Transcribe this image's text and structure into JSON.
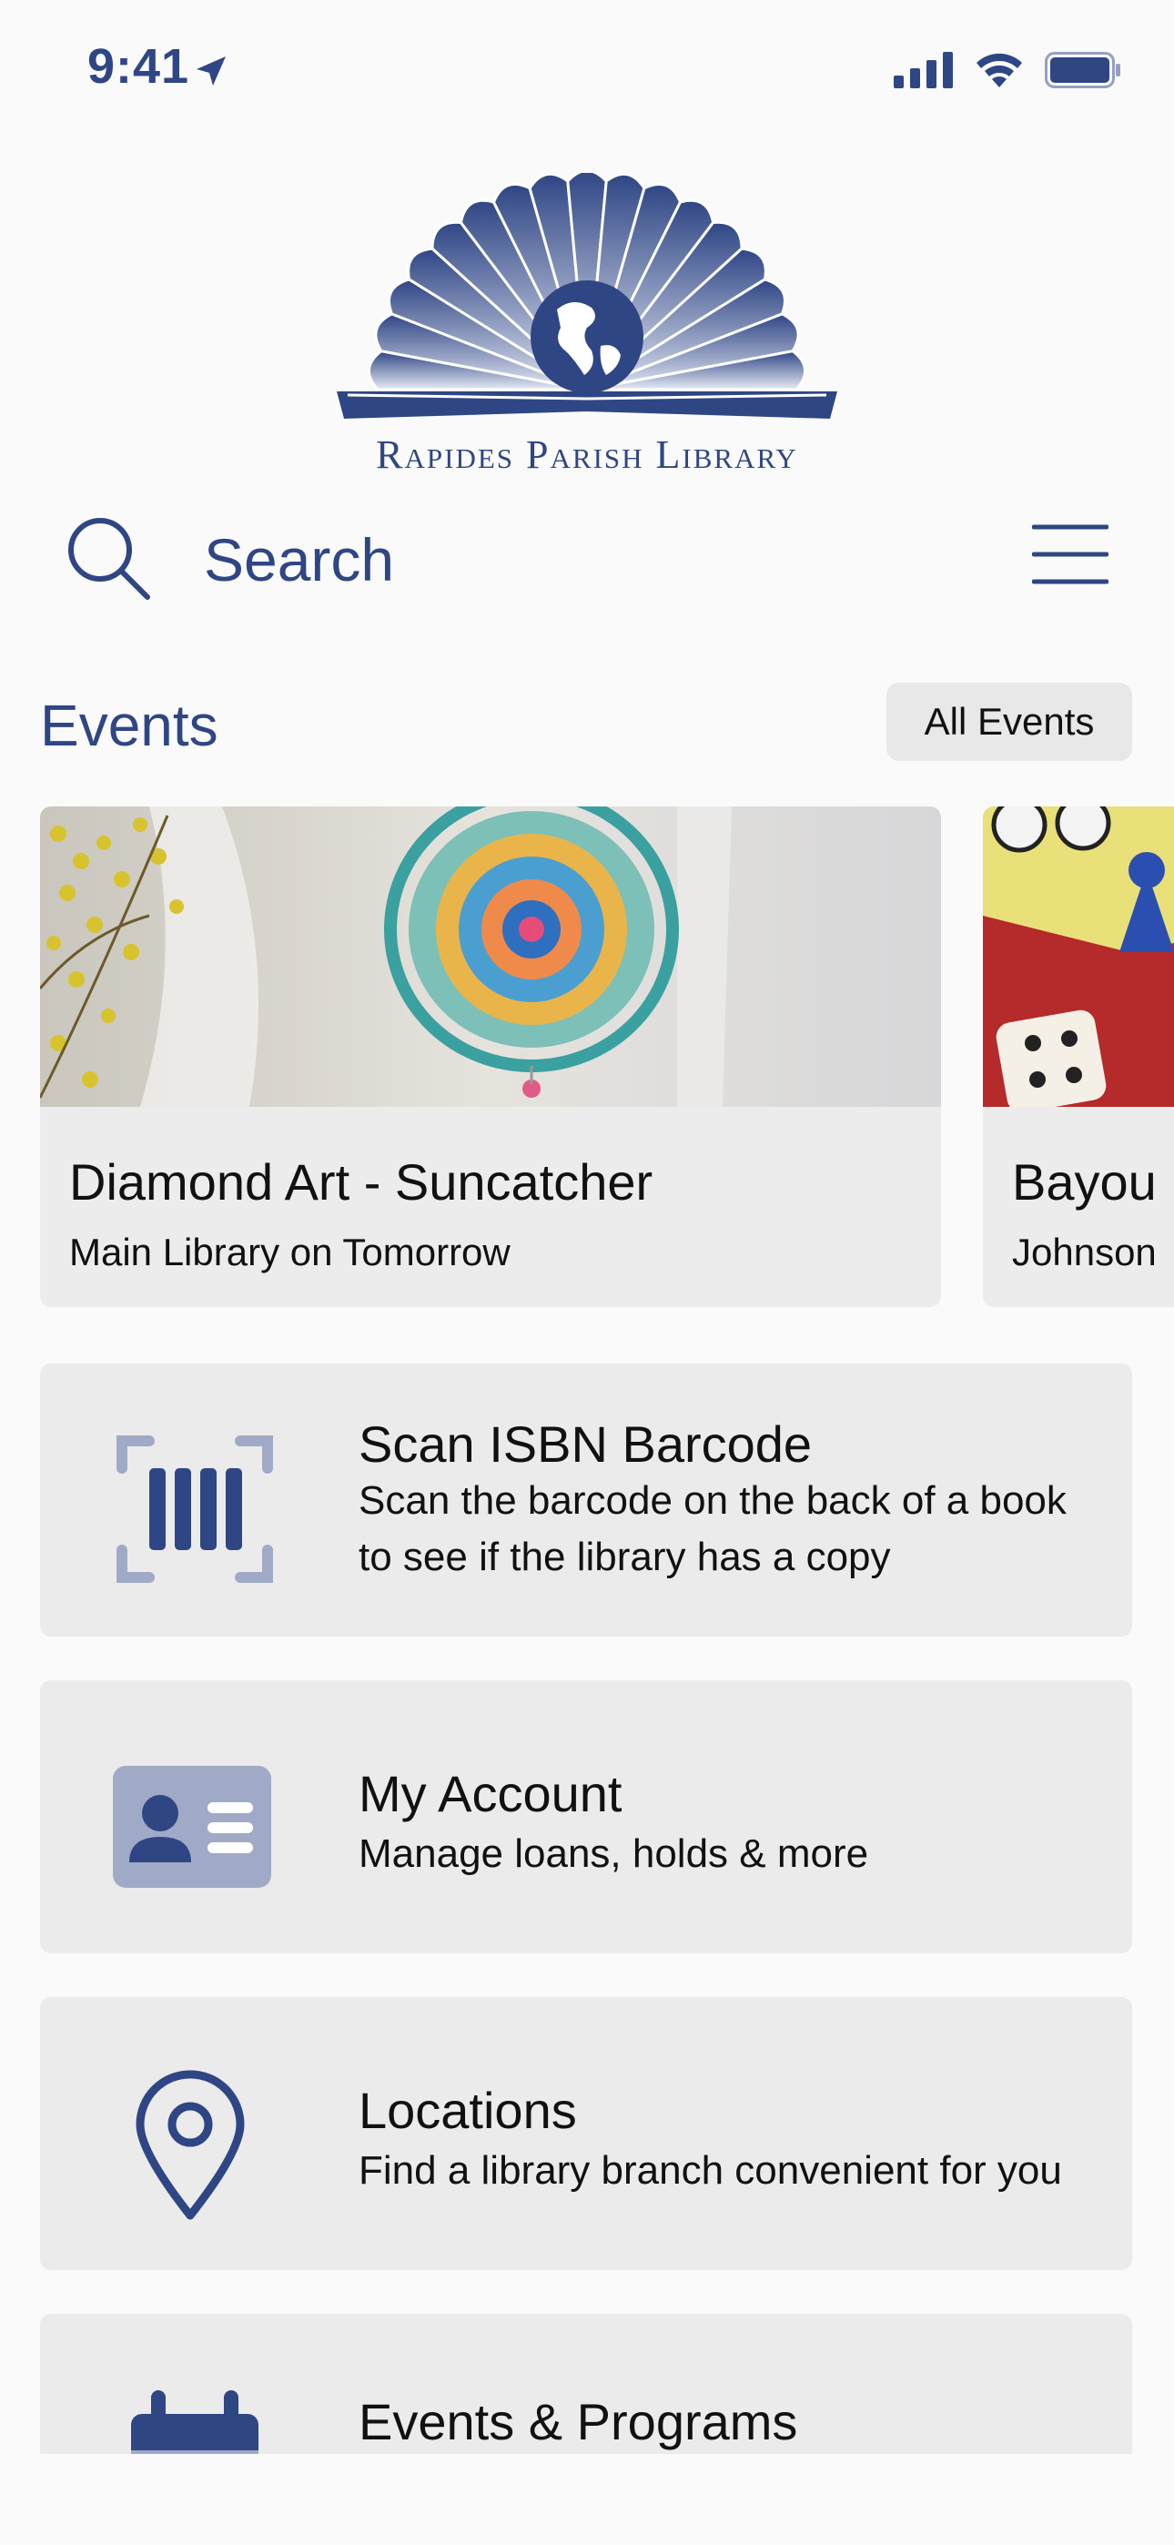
{
  "status_bar": {
    "time": "9:41"
  },
  "logo": {
    "text": "Rapides Parish Library"
  },
  "search": {
    "placeholder": "Search"
  },
  "events": {
    "title": "Events",
    "all_button": "All Events",
    "cards": [
      {
        "title": "Diamond Art - Suncatcher",
        "subtitle": "Main Library on Tomorrow"
      },
      {
        "title": "Bayou",
        "subtitle": "Johnson"
      }
    ]
  },
  "tiles": [
    {
      "title": "Scan ISBN Barcode",
      "desc": "Scan the barcode on the back of a book to see if the library has a copy",
      "icon": "barcode-scan-icon"
    },
    {
      "title": "My Account",
      "desc": "Manage loans, holds & more",
      "icon": "id-card-icon"
    },
    {
      "title": "Locations",
      "desc": "Find a library branch convenient for you",
      "icon": "map-pin-icon"
    },
    {
      "title": "Events & Programs",
      "desc": "",
      "icon": "calendar-icon"
    }
  ],
  "colors": {
    "brand": "#2f4685",
    "tile_bg": "#ebebeb",
    "icon_light": "#a0aac6"
  }
}
